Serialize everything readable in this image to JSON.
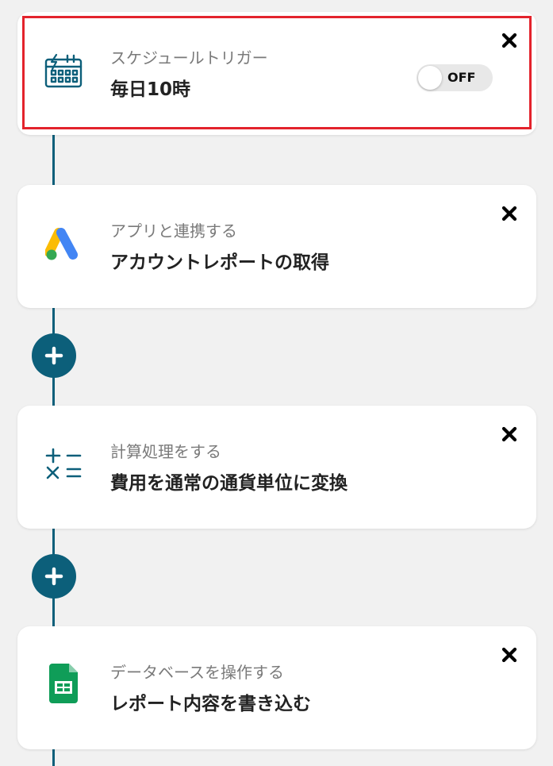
{
  "steps": [
    {
      "subtitle": "スケジュールトリガー",
      "title": "毎日10時",
      "icon": "calendar-trigger-icon",
      "toggle_label": "OFF",
      "toggle_state": "off"
    },
    {
      "subtitle": "アプリと連携する",
      "title": "アカウントレポートの取得",
      "icon": "google-ads-icon"
    },
    {
      "subtitle": "計算処理をする",
      "title": "費用を通常の通貨単位に変換",
      "icon": "calculation-icon"
    },
    {
      "subtitle": "データベースを操作する",
      "title": "レポート内容を書き込む",
      "icon": "google-sheets-icon"
    }
  ],
  "colors": {
    "accent": "#0c5f7a",
    "highlight_border": "#e3232c",
    "background": "#f1f1f1",
    "card": "#ffffff"
  }
}
